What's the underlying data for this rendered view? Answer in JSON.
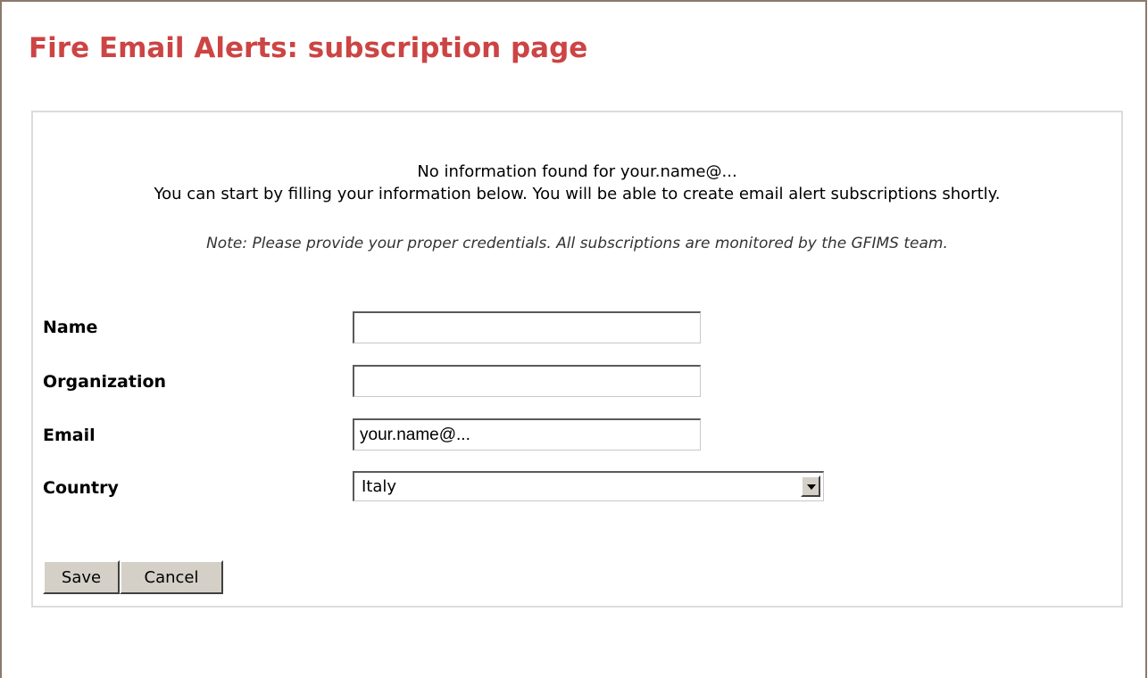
{
  "page": {
    "title": "Fire Email Alerts: subscription page"
  },
  "messages": {
    "line1": "No information found for your.name@...",
    "line2": "You can start by filling your information below. You will be able to create email alert subscriptions shortly.",
    "note": "Note: Please provide your proper credentials. All subscriptions are monitored by the GFIMS team."
  },
  "form": {
    "name": {
      "label": "Name",
      "value": ""
    },
    "organization": {
      "label": "Organization",
      "value": ""
    },
    "email": {
      "label": "Email",
      "value": "your.name@..."
    },
    "country": {
      "label": "Country",
      "selected": "Italy",
      "arrow_icon": "chevron-down-icon"
    }
  },
  "buttons": {
    "save_label": "Save",
    "cancel_label": "Cancel"
  },
  "colors": {
    "title": "#cc4444",
    "button_face": "#d4d0c8",
    "panel_border": "#dcdcdc"
  }
}
